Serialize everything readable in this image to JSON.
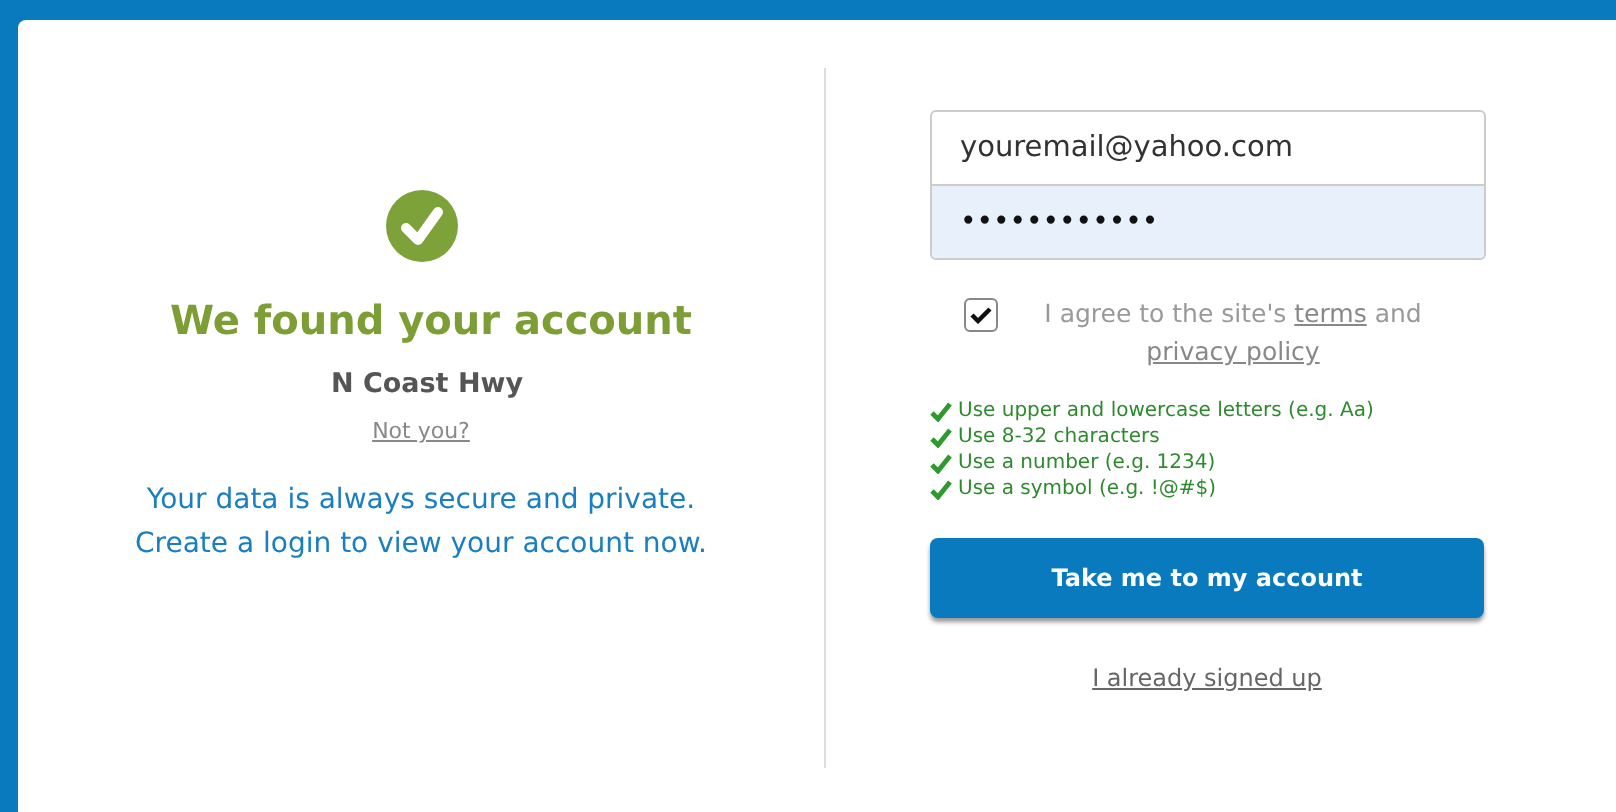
{
  "account": {
    "title": "We found your account",
    "address": "N Coast Hwy",
    "not_you": "Not you?",
    "message": "Your data is always secure and private. Create a login to view your account now."
  },
  "form": {
    "email": {
      "value": "youremail@yahoo.com"
    },
    "password": {
      "value": "••••••••••••",
      "focused": true
    },
    "agreement": {
      "checked": true,
      "before": "I agree to the site's ",
      "terms_link": "terms",
      "middle": " and ",
      "privacy_link": "privacy policy"
    },
    "rules": [
      {
        "text": "Use upper and lowercase letters (e.g. Aa)",
        "met": true
      },
      {
        "text": "Use 8-32 characters",
        "met": true
      },
      {
        "text": "Use a number (e.g. 1234)",
        "met": true
      },
      {
        "text": "Use a symbol (e.g. !@#$)",
        "met": true
      }
    ],
    "submit": "Take me to my account",
    "signed_up_link": "I already signed up"
  }
}
